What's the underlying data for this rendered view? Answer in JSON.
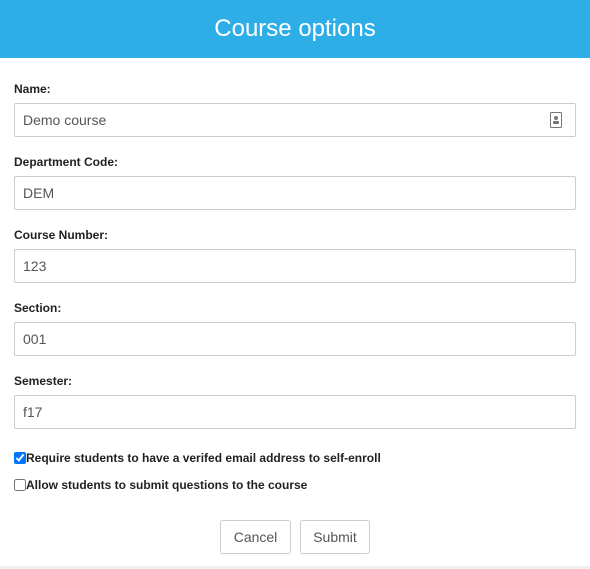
{
  "dialog": {
    "title": "Course options",
    "header_color": "#2eaee6"
  },
  "fields": {
    "name": {
      "label": "Name:",
      "value": "Demo course"
    },
    "department_code": {
      "label": "Department Code:",
      "value": "DEM"
    },
    "course_number": {
      "label": "Course Number:",
      "value": "123"
    },
    "section": {
      "label": "Section:",
      "value": "001"
    },
    "semester": {
      "label": "Semester:",
      "value": "f17"
    }
  },
  "options": {
    "verified_email": {
      "label": "Require students to have a verifed email address to self-enroll",
      "checked": true
    },
    "submit_questions": {
      "label": "Allow students to submit questions to the course",
      "checked": false
    }
  },
  "buttons": {
    "cancel_label": "Cancel",
    "submit_label": "Submit"
  },
  "icons": {
    "name_field_icon": "contact-card-icon"
  }
}
